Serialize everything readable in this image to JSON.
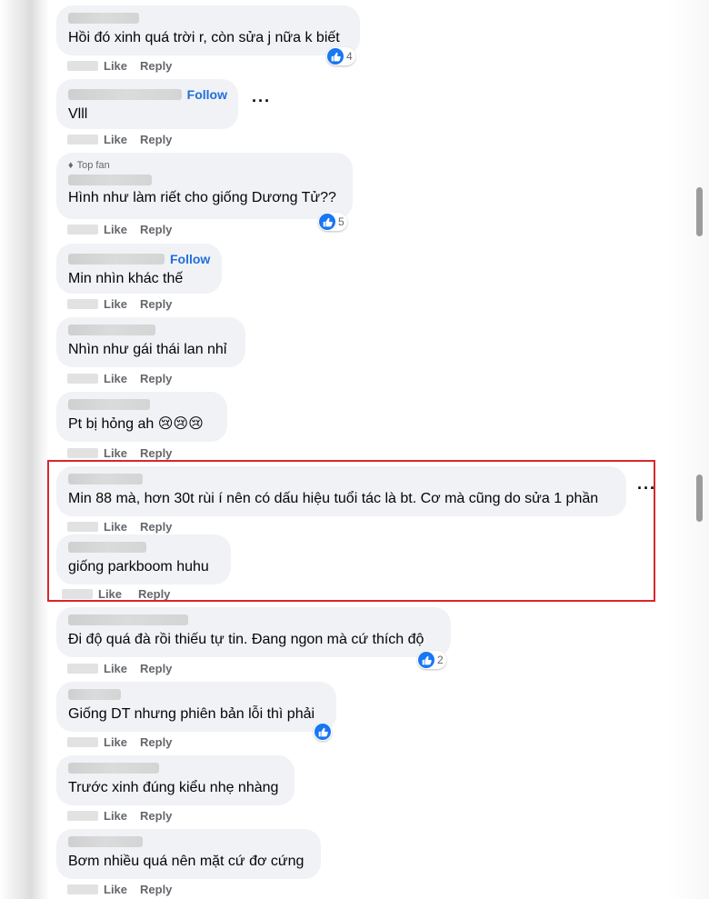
{
  "actions": {
    "like": "Like",
    "reply": "Reply",
    "follow": "Follow",
    "more": "···"
  },
  "comments": [
    {
      "text": "Hồi đó xinh quá trời r, còn sửa j nữa k biết",
      "reactions": "4"
    },
    {
      "text": "Vlll"
    },
    {
      "badge": "Top fan",
      "text": "Hình như làm riết cho giống Dương Tử??",
      "reactions": "5"
    },
    {
      "text": "Min nhìn khác thế"
    },
    {
      "text": "Nhìn như gái thái lan nhỉ"
    },
    {
      "text": "Pt bị hỏng ah 😢😢😢"
    },
    {
      "text": "Min 88 mà, hơn 30t rùi í nên có dấu hiệu tuổi tác là bt. Cơ mà cũng do sửa 1 phần"
    },
    {
      "text": "giống parkboom huhu"
    },
    {
      "text": "Đi độ quá đà rồi thiếu tự tin. Đang ngon mà cứ thích độ",
      "reactions": "2"
    },
    {
      "text": "Giống DT nhưng phiên bản lỗi thì phải"
    },
    {
      "text": "Trước xinh đúng kiểu nhẹ nhàng"
    },
    {
      "text": "Bơm nhiều quá nên mặt cứ đơ cứng"
    }
  ],
  "colors": {
    "like_blue": "#1877f2",
    "follow_blue": "#216fdb",
    "highlight_red": "#d9262c",
    "bubble_bg": "#f0f2f5"
  },
  "icons": {
    "like": "thumbs-up-icon",
    "top_fan": "diamond-icon",
    "more": "more-options-icon"
  }
}
